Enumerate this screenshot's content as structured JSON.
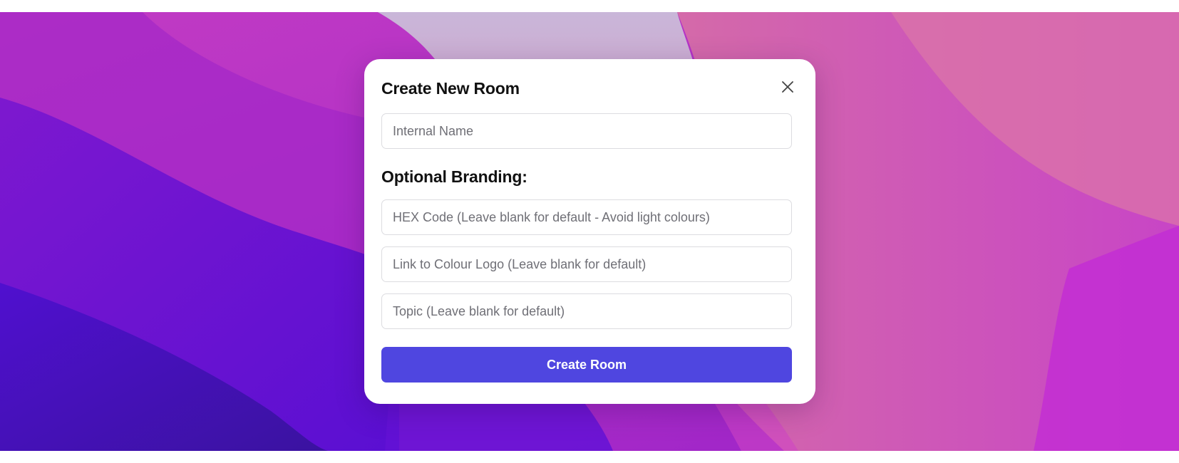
{
  "modal": {
    "title": "Create New Room",
    "close_icon": "close-icon",
    "internal_name": {
      "placeholder": "Internal Name",
      "value": ""
    },
    "branding_heading": "Optional Branding:",
    "hex_code": {
      "placeholder": "HEX Code (Leave blank for default - Avoid light colours)",
      "value": ""
    },
    "logo_link": {
      "placeholder": "Link to Colour Logo (Leave blank for default)",
      "value": ""
    },
    "topic": {
      "placeholder": "Topic (Leave blank for default)",
      "value": ""
    },
    "submit_label": "Create Room"
  },
  "colors": {
    "accent": "#4f46e0",
    "wallpaper_primary": "#8a1fd0",
    "wallpaper_secondary": "#e06aa8"
  }
}
